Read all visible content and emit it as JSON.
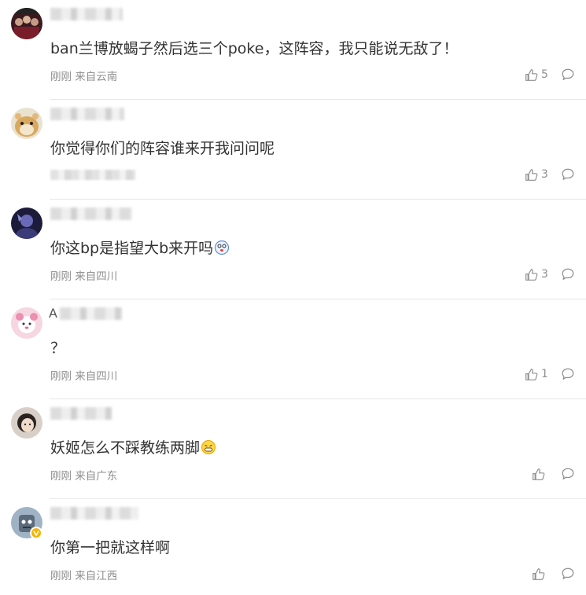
{
  "comments": [
    {
      "text": "ban兰博放蝎子然后选三个poke，这阵容，我只能说无敌了！",
      "meta": "刚刚 来自云南",
      "likes": "5",
      "avatar_icon": "avatar-group-photo-icon"
    },
    {
      "text": "你觉得你们的阵容谁来开我问问呢",
      "meta": "",
      "likes": "3",
      "avatar_icon": "avatar-hamster-icon"
    },
    {
      "text": "你这bp是指望大b来开吗",
      "meta": "刚刚 来自四川",
      "likes": "3",
      "avatar_icon": "avatar-dark-portrait-icon"
    },
    {
      "name_prefix": "A",
      "text": "？",
      "meta": "刚刚 来自四川",
      "likes": "1",
      "avatar_icon": "avatar-pink-character-icon"
    },
    {
      "text": "妖姬怎么不踩教练两脚",
      "meta": "刚刚 来自广东",
      "likes": "",
      "avatar_icon": "avatar-girl-portrait-icon"
    },
    {
      "text": "你第一把就这样啊",
      "meta": "刚刚 来自江西",
      "likes": "",
      "avatar_icon": "avatar-cartoon-icon"
    }
  ],
  "icons": {
    "like": "thumbs-up-icon",
    "reply": "comment-bubble-icon",
    "verified": "verified-badge-icon"
  },
  "colors": {
    "text": "#333333",
    "meta": "#8f8f8f",
    "divider": "#e8e8e8",
    "badge": "#f7b500"
  }
}
